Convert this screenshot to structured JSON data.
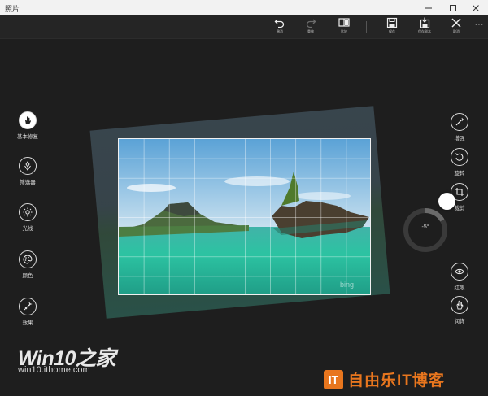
{
  "window": {
    "title": "照片",
    "controls": [
      "minimize",
      "maximize",
      "close"
    ]
  },
  "toolbar": {
    "undo": "撤消",
    "redo": "重做",
    "compare": "比较",
    "save": "保存",
    "save_copy": "保存副本",
    "cancel": "取消",
    "more": "···"
  },
  "left_tools": [
    {
      "label": "基本修复",
      "icon": "hand-icon",
      "active": true
    },
    {
      "label": "筛选器",
      "icon": "filter-icon",
      "active": false
    },
    {
      "label": "光线",
      "icon": "sun-icon",
      "active": false
    },
    {
      "label": "颜色",
      "icon": "palette-icon",
      "active": false
    },
    {
      "label": "效果",
      "icon": "effects-icon",
      "active": false
    }
  ],
  "right_tools": [
    {
      "label": "增强",
      "icon": "wand-icon"
    },
    {
      "label": "旋转",
      "icon": "rotate-icon"
    },
    {
      "label": "裁剪",
      "icon": "crop-icon"
    },
    {
      "label": "红眼",
      "icon": "eye-icon"
    },
    {
      "label": "润饰",
      "icon": "retouch-icon"
    }
  ],
  "rotation": {
    "value": "-5°",
    "degrees": -5
  },
  "photo": {
    "watermark": "bing",
    "colors": {
      "sky": "#7fb6dd",
      "sea": "#2fbfa0",
      "rock": "#4a4030"
    }
  },
  "watermarks": {
    "logo": "Win10之家",
    "url": "win10.ithome.com",
    "brand_icon": "IT",
    "brand": "自由乐IT博客"
  }
}
